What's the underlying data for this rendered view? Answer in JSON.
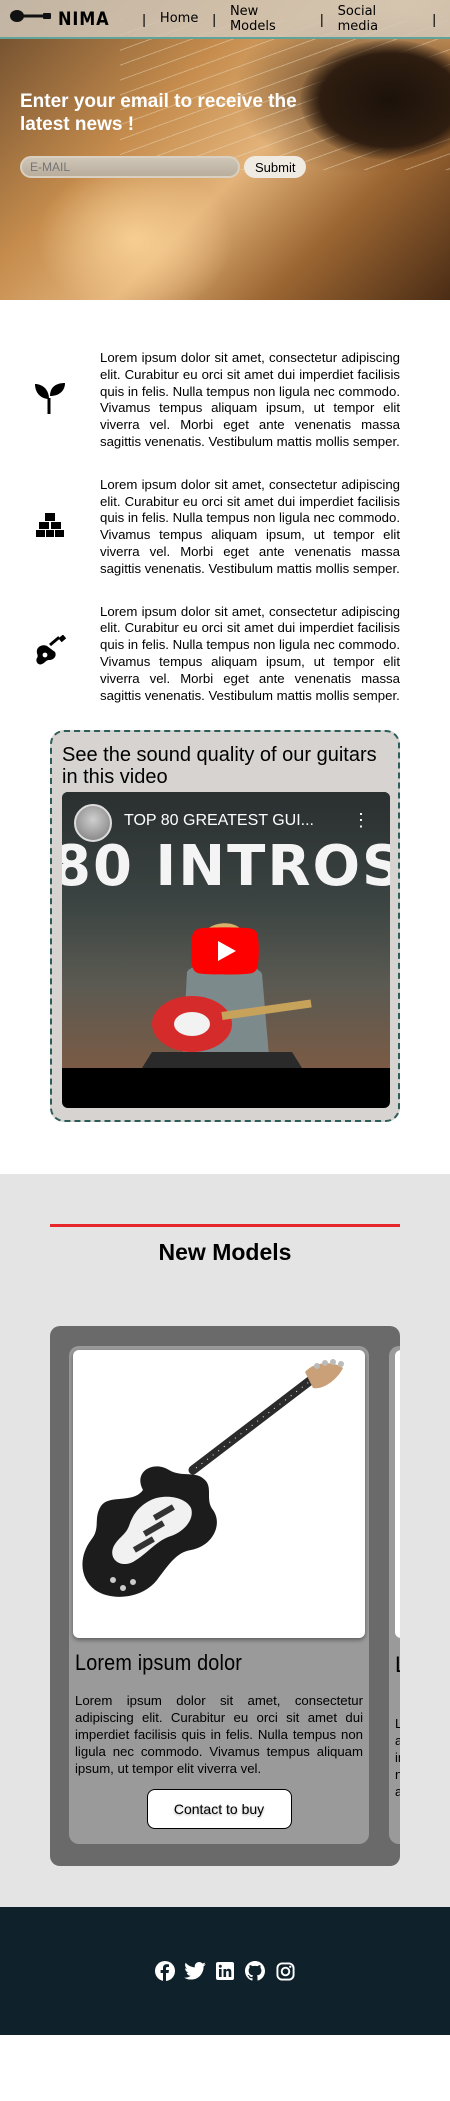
{
  "header": {
    "logo_text": "NIMA",
    "nav": [
      {
        "label": "Home"
      },
      {
        "label": "New Models"
      },
      {
        "label": "Social media"
      }
    ]
  },
  "hero": {
    "title": "Enter your email to receive the latest news !",
    "email_placeholder": "E-MAIL",
    "submit_label": "Submit"
  },
  "features": [
    {
      "icon": "seedling-icon",
      "text": "Lorem ipsum dolor sit amet, consectetur adipiscing elit. Curabitur eu orci sit amet dui imperdiet facilisis quis in felis. Nulla tempus non ligula nec commodo. Vivamus tempus aliquam ipsum, ut tempor elit viverra vel. Morbi eget ante venenatis massa sagittis venenatis. Vestibulum mattis mollis semper."
    },
    {
      "icon": "cubes-icon",
      "text": "Lorem ipsum dolor sit amet, consectetur adipiscing elit. Curabitur eu orci sit amet dui imperdiet facilisis quis in felis. Nulla tempus non ligula nec commodo. Vivamus tempus aliquam ipsum, ut tempor elit viverra vel. Morbi eget ante venenatis massa sagittis venenatis. Vestibulum mattis mollis semper."
    },
    {
      "icon": "guitar-icon",
      "text": "Lorem ipsum dolor sit amet, consectetur adipiscing elit. Curabitur eu orci sit amet dui imperdiet facilisis quis in felis. Nulla tempus non ligula nec commodo. Vivamus tempus aliquam ipsum, ut tempor elit viverra vel. Morbi eget ante venenatis massa sagittis venenatis. Vestibulum mattis mollis semper."
    }
  ],
  "video": {
    "heading": "See the sound quality of our guitars in this video",
    "title": "TOP 80 GREATEST GUI...",
    "thumbnail_text": "80 INTROS"
  },
  "models": {
    "heading": "New Models",
    "cards": [
      {
        "title": "Lorem ipsum dolor",
        "text": "Lorem ipsum dolor sit amet, consectetur adipiscing elit. Curabitur eu orci sit amet dui imperdiet facilisis quis in felis. Nulla tempus non ligula nec commodo. Vivamus tempus aliquam ipsum, ut tempor elit viverra vel.",
        "button_label": "Contact to buy"
      }
    ],
    "next_card_peek": {
      "title": "L",
      "lines": [
        "L",
        "a",
        "in",
        "n",
        "a"
      ]
    }
  },
  "footer": {
    "social_icons": [
      "facebook-icon",
      "twitter-icon",
      "linkedin-icon",
      "github-icon",
      "instagram-icon"
    ]
  },
  "colors": {
    "accent_red": "#e8272c",
    "footer_bg": "#0f222c",
    "card_border": "#2d5d58"
  }
}
